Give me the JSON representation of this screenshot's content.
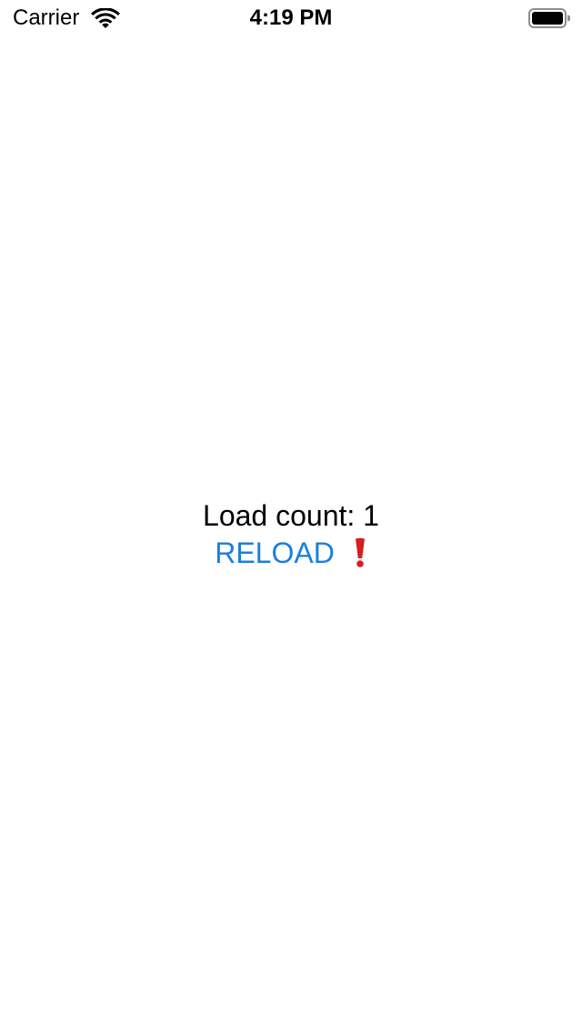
{
  "status_bar": {
    "carrier": "Carrier",
    "time": "4:19 PM",
    "wifi_icon": "wifi-icon",
    "battery_icon": "battery-icon"
  },
  "main": {
    "load_count_label": "Load count: 1",
    "reload_label": "RELOAD",
    "error_icon": "exclamation-icon"
  },
  "colors": {
    "accent": "#1B7FDE",
    "error": "#D81E1E",
    "text": "#000000",
    "background": "#FFFFFF"
  }
}
